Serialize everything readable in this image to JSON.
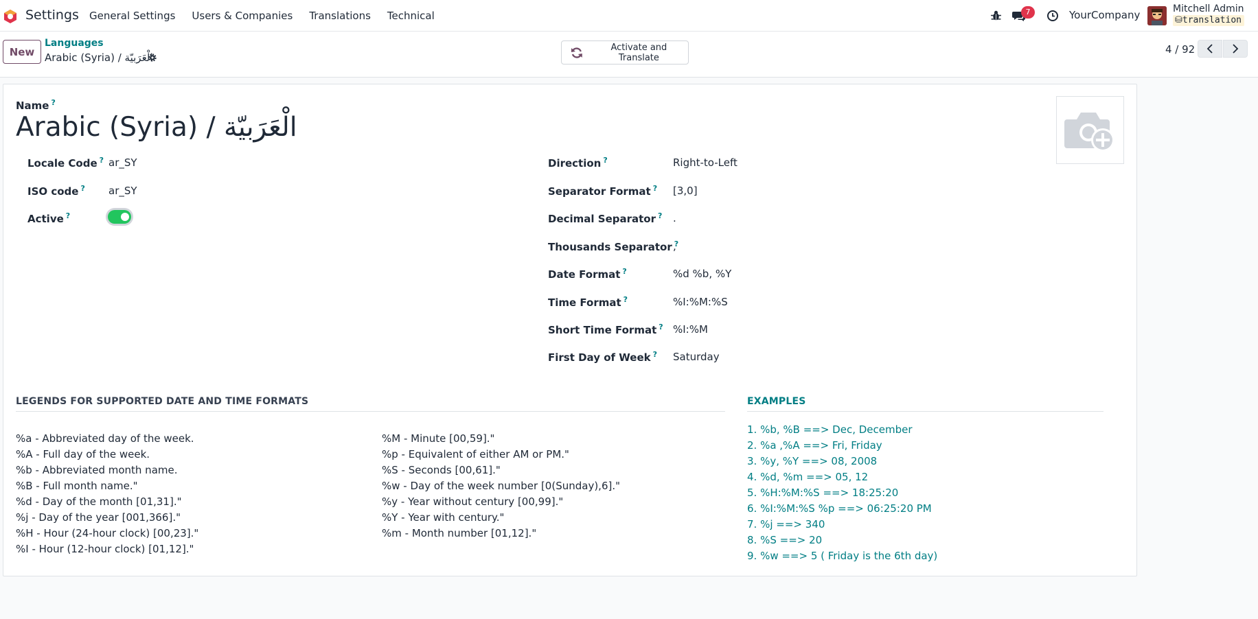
{
  "navbar": {
    "app_name": "Settings",
    "menu": [
      "General Settings",
      "Users & Companies",
      "Translations",
      "Technical"
    ],
    "messages_badge": "7",
    "company": "YourCompany",
    "user_name": "Mitchell Admin",
    "database": "translation"
  },
  "control": {
    "new_label": "New",
    "breadcrumb_parent": "Languages",
    "breadcrumb_current": "Arabic (Syria) / الْعَرَبيّة",
    "action_label": "Activate and Translate",
    "pager": "4 / 92"
  },
  "form": {
    "name_label": "Name",
    "help_mark": "?",
    "name_value": "Arabic (Syria) / الْعَرَبيّة",
    "left_fields": [
      {
        "label": "Locale Code",
        "value": "ar_SY"
      },
      {
        "label": "ISO code",
        "value": "ar_SY"
      },
      {
        "label": "Active",
        "value": ""
      }
    ],
    "active": true,
    "right_fields": [
      {
        "label": "Direction",
        "value": "Right-to-Left"
      },
      {
        "label": "Separator Format",
        "value": "[3,0]"
      },
      {
        "label": "Decimal Separator",
        "value": "."
      },
      {
        "label": "Thousands Separator",
        "value": ","
      },
      {
        "label": "Date Format",
        "value": "%d %b, %Y"
      },
      {
        "label": "Time Format",
        "value": "%I:%M:%S"
      },
      {
        "label": "Short Time Format",
        "value": "%I:%M"
      },
      {
        "label": "First Day of Week",
        "value": "Saturday"
      }
    ]
  },
  "legends": {
    "title": "LEGENDS FOR SUPPORTED DATE AND TIME FORMATS",
    "col1": [
      "%a - Abbreviated day of the week.",
      "%A - Full day of the week.",
      "%b - Abbreviated month name.",
      "%B - Full month name.\"",
      "%d - Day of the month [01,31].\"",
      "%j - Day of the year [001,366].\"",
      "%H - Hour (24-hour clock) [00,23].\"",
      "%I - Hour (12-hour clock) [01,12].\""
    ],
    "col2": [
      "%M - Minute [00,59].\"",
      "%p - Equivalent of either AM or PM.\"",
      "%S - Seconds [00,61].\"",
      "%w - Day of the week number [0(Sunday),6].\"",
      "%y - Year without century [00,99].\"",
      "%Y - Year with century.\"",
      "%m - Month number [01,12].\""
    ]
  },
  "examples": {
    "title": "EXAMPLES",
    "items": [
      "1. %b, %B ==> Dec, December",
      "2. %a ,%A ==> Fri, Friday",
      "3. %y, %Y ==> 08, 2008",
      "4. %d, %m ==> 05, 12",
      "5. %H:%M:%S ==> 18:25:20",
      "6. %I:%M:%S %p ==> 06:25:20 PM",
      "7. %j ==> 340",
      "8. %S ==> 20",
      "9. %w ==> 5 ( Friday is the 6th day)"
    ]
  },
  "colors": {
    "primary": "#714b67",
    "link": "#017e84",
    "toggle_on": "#22c55e",
    "badge": "#e0334b"
  }
}
